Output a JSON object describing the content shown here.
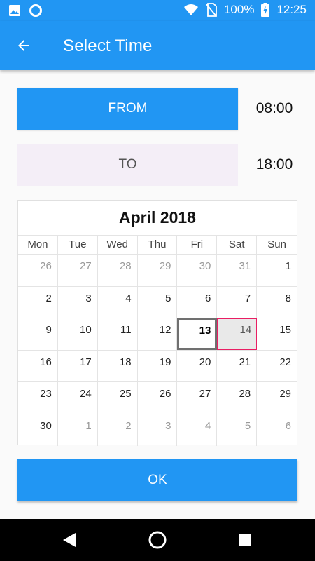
{
  "status_bar": {
    "battery_text": "100%",
    "time": "12:25",
    "icons": [
      "image-icon",
      "circle-icon",
      "wifi-icon",
      "no-sim-icon",
      "battery-charging-icon"
    ]
  },
  "app_bar": {
    "title": "Select Time",
    "back_icon": "arrow-left-icon"
  },
  "range": {
    "from_label": "FROM",
    "from_time": "08:00",
    "to_label": "TO",
    "to_time": "18:00"
  },
  "calendar": {
    "month_title": "April 2018",
    "weekdays": [
      "Mon",
      "Tue",
      "Wed",
      "Thu",
      "Fri",
      "Sat",
      "Sun"
    ],
    "weeks": [
      [
        "26",
        "27",
        "28",
        "29",
        "30",
        "31",
        "1"
      ],
      [
        "2",
        "3",
        "4",
        "5",
        "6",
        "7",
        "8"
      ],
      [
        "9",
        "10",
        "11",
        "12",
        "13",
        "14",
        "15"
      ],
      [
        "16",
        "17",
        "18",
        "19",
        "20",
        "21",
        "22"
      ],
      [
        "23",
        "24",
        "25",
        "26",
        "27",
        "28",
        "29"
      ],
      [
        "30",
        "1",
        "2",
        "3",
        "4",
        "5",
        "6"
      ]
    ],
    "selected_day": "13",
    "range_end_day": "14"
  },
  "ok_label": "OK",
  "colors": {
    "primary": "#2196f3",
    "to_button_bg": "#f4eef7",
    "range_border": "#e91e63"
  },
  "nav_bar": {
    "icons": [
      "nav-back-icon",
      "nav-home-icon",
      "nav-recents-icon"
    ]
  }
}
